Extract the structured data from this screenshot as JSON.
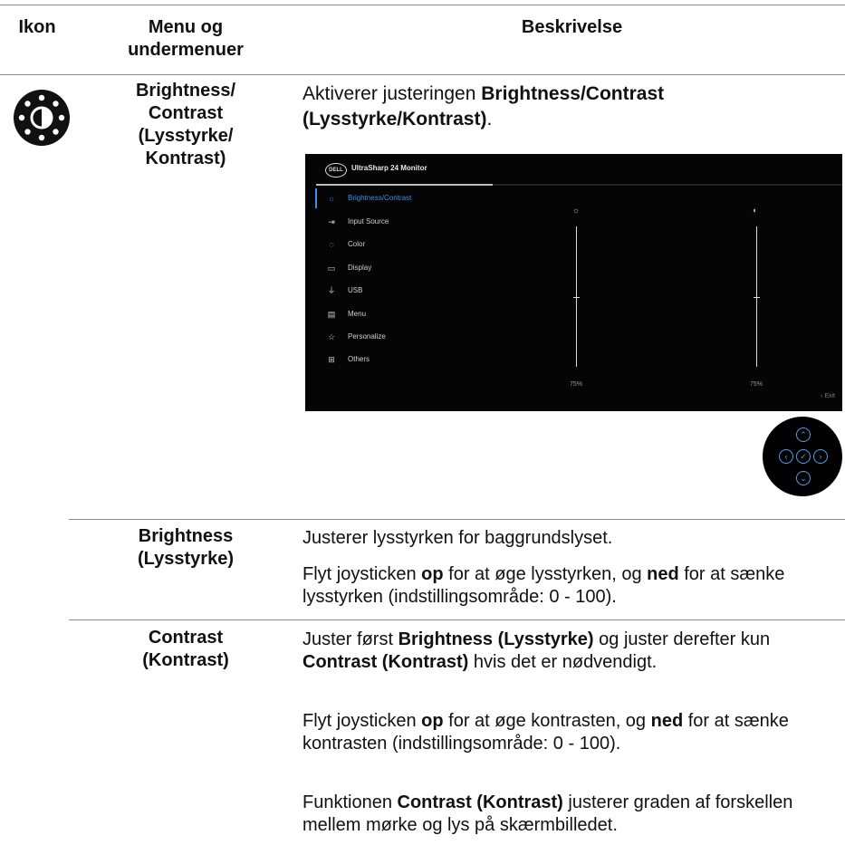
{
  "headers": {
    "icon": "Ikon",
    "menu": "Menu og undermenuer",
    "description": "Beskrivelse"
  },
  "row1": {
    "icon_name": "brightness-contrast-icon",
    "menu_name": "Brightness/ Contrast (Lysstyrke/ Kontrast)",
    "desc_prefix": "Aktiverer justeringen ",
    "desc_bold": "Brightness/Contrast (Lysstyrke/Kontrast)",
    "desc_suffix": "."
  },
  "osd": {
    "logo": "DELL",
    "title": "UltraSharp 24 Monitor",
    "menu": [
      {
        "label": "Brightness/Contrast",
        "icon": "sun-icon"
      },
      {
        "label": "Input Source",
        "icon": "input-icon"
      },
      {
        "label": "Color",
        "icon": "palette-icon"
      },
      {
        "label": "Display",
        "icon": "display-icon"
      },
      {
        "label": "USB",
        "icon": "usb-icon"
      },
      {
        "label": "Menu",
        "icon": "menu-icon"
      },
      {
        "label": "Personalize",
        "icon": "star-icon"
      },
      {
        "label": "Others",
        "icon": "others-icon"
      }
    ],
    "brightness_value": "75%",
    "contrast_value": "75%",
    "brightness_level": 0.5,
    "contrast_level": 0.5,
    "exit_label": "Exit"
  },
  "row2": {
    "name": "Brightness (Lysstyrke)",
    "p1": "Justerer lysstyrken for baggrundslyset.",
    "p2_a": "Flyt joysticken ",
    "p2_op": "op",
    "p2_b": " for at øge lysstyrken, og ",
    "p2_ned": "ned",
    "p2_c": " for at sænke lysstyrken (indstillingsområde: 0 - 100)."
  },
  "row3": {
    "name": "Contrast (Kontrast)",
    "p1_a": "Juster først ",
    "p1_b1": "Brightness (Lysstyrke)",
    "p1_b": " og juster derefter kun ",
    "p1_b2": "Contrast (Kontrast)",
    "p1_c": " hvis det er nødvendigt.",
    "p2_a": "Flyt joysticken ",
    "p2_op": "op",
    "p2_b": " for at øge kontrasten, og ",
    "p2_ned": "ned",
    "p2_c": " for at sænke kontrasten (indstillingsområde: 0 - 100).",
    "p3_a": "Funktionen ",
    "p3_b": "Contrast (Kontrast)",
    "p3_c": " justerer graden af forskellen mellem mørke og lys på skærmbilledet."
  }
}
